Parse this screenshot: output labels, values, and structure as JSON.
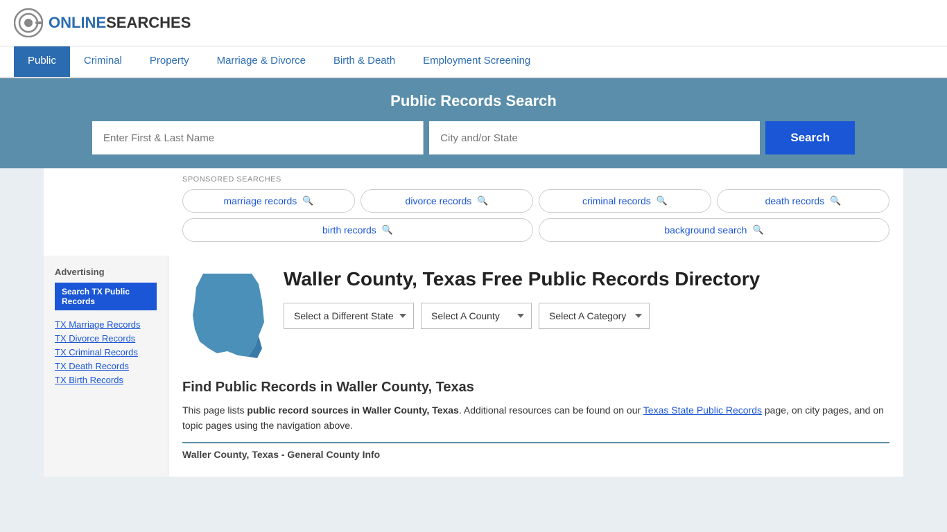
{
  "header": {
    "logo_text_online": "ONLINE",
    "logo_text_searches": "SEARCHES"
  },
  "nav": {
    "items": [
      {
        "label": "Public",
        "active": true
      },
      {
        "label": "Criminal",
        "active": false
      },
      {
        "label": "Property",
        "active": false
      },
      {
        "label": "Marriage & Divorce",
        "active": false
      },
      {
        "label": "Birth & Death",
        "active": false
      },
      {
        "label": "Employment Screening",
        "active": false
      }
    ]
  },
  "search_banner": {
    "title": "Public Records Search",
    "name_placeholder": "Enter First & Last Name",
    "location_placeholder": "City and/or State",
    "button_label": "Search"
  },
  "sponsored": {
    "label": "SPONSORED SEARCHES",
    "tags": [
      {
        "label": "marriage records"
      },
      {
        "label": "divorce records"
      },
      {
        "label": "criminal records"
      },
      {
        "label": "death records"
      },
      {
        "label": "birth records"
      },
      {
        "label": "background search"
      }
    ]
  },
  "county": {
    "title": "Waller County, Texas Free Public Records Directory"
  },
  "dropdowns": {
    "state_label": "Select a Different State",
    "county_label": "Select A County",
    "category_label": "Select A Category"
  },
  "find_section": {
    "heading": "Find Public Records in Waller County, Texas",
    "paragraph_start": "This page lists ",
    "bold_text": "public record sources in Waller County, Texas",
    "paragraph_middle": ". Additional resources can be found on our ",
    "link_text": "Texas State Public Records",
    "paragraph_end": " page, on city pages, and on topic pages using the navigation above."
  },
  "table_section": {
    "header": "Waller County, Texas - General County Info"
  },
  "sidebar": {
    "advertising_label": "Advertising",
    "ad_button": "Search TX Public Records",
    "links": [
      {
        "label": "TX Marriage Records"
      },
      {
        "label": "TX Divorce Records"
      },
      {
        "label": "TX Criminal Records"
      },
      {
        "label": "TX Death Records"
      },
      {
        "label": "TX Birth Records"
      }
    ]
  }
}
